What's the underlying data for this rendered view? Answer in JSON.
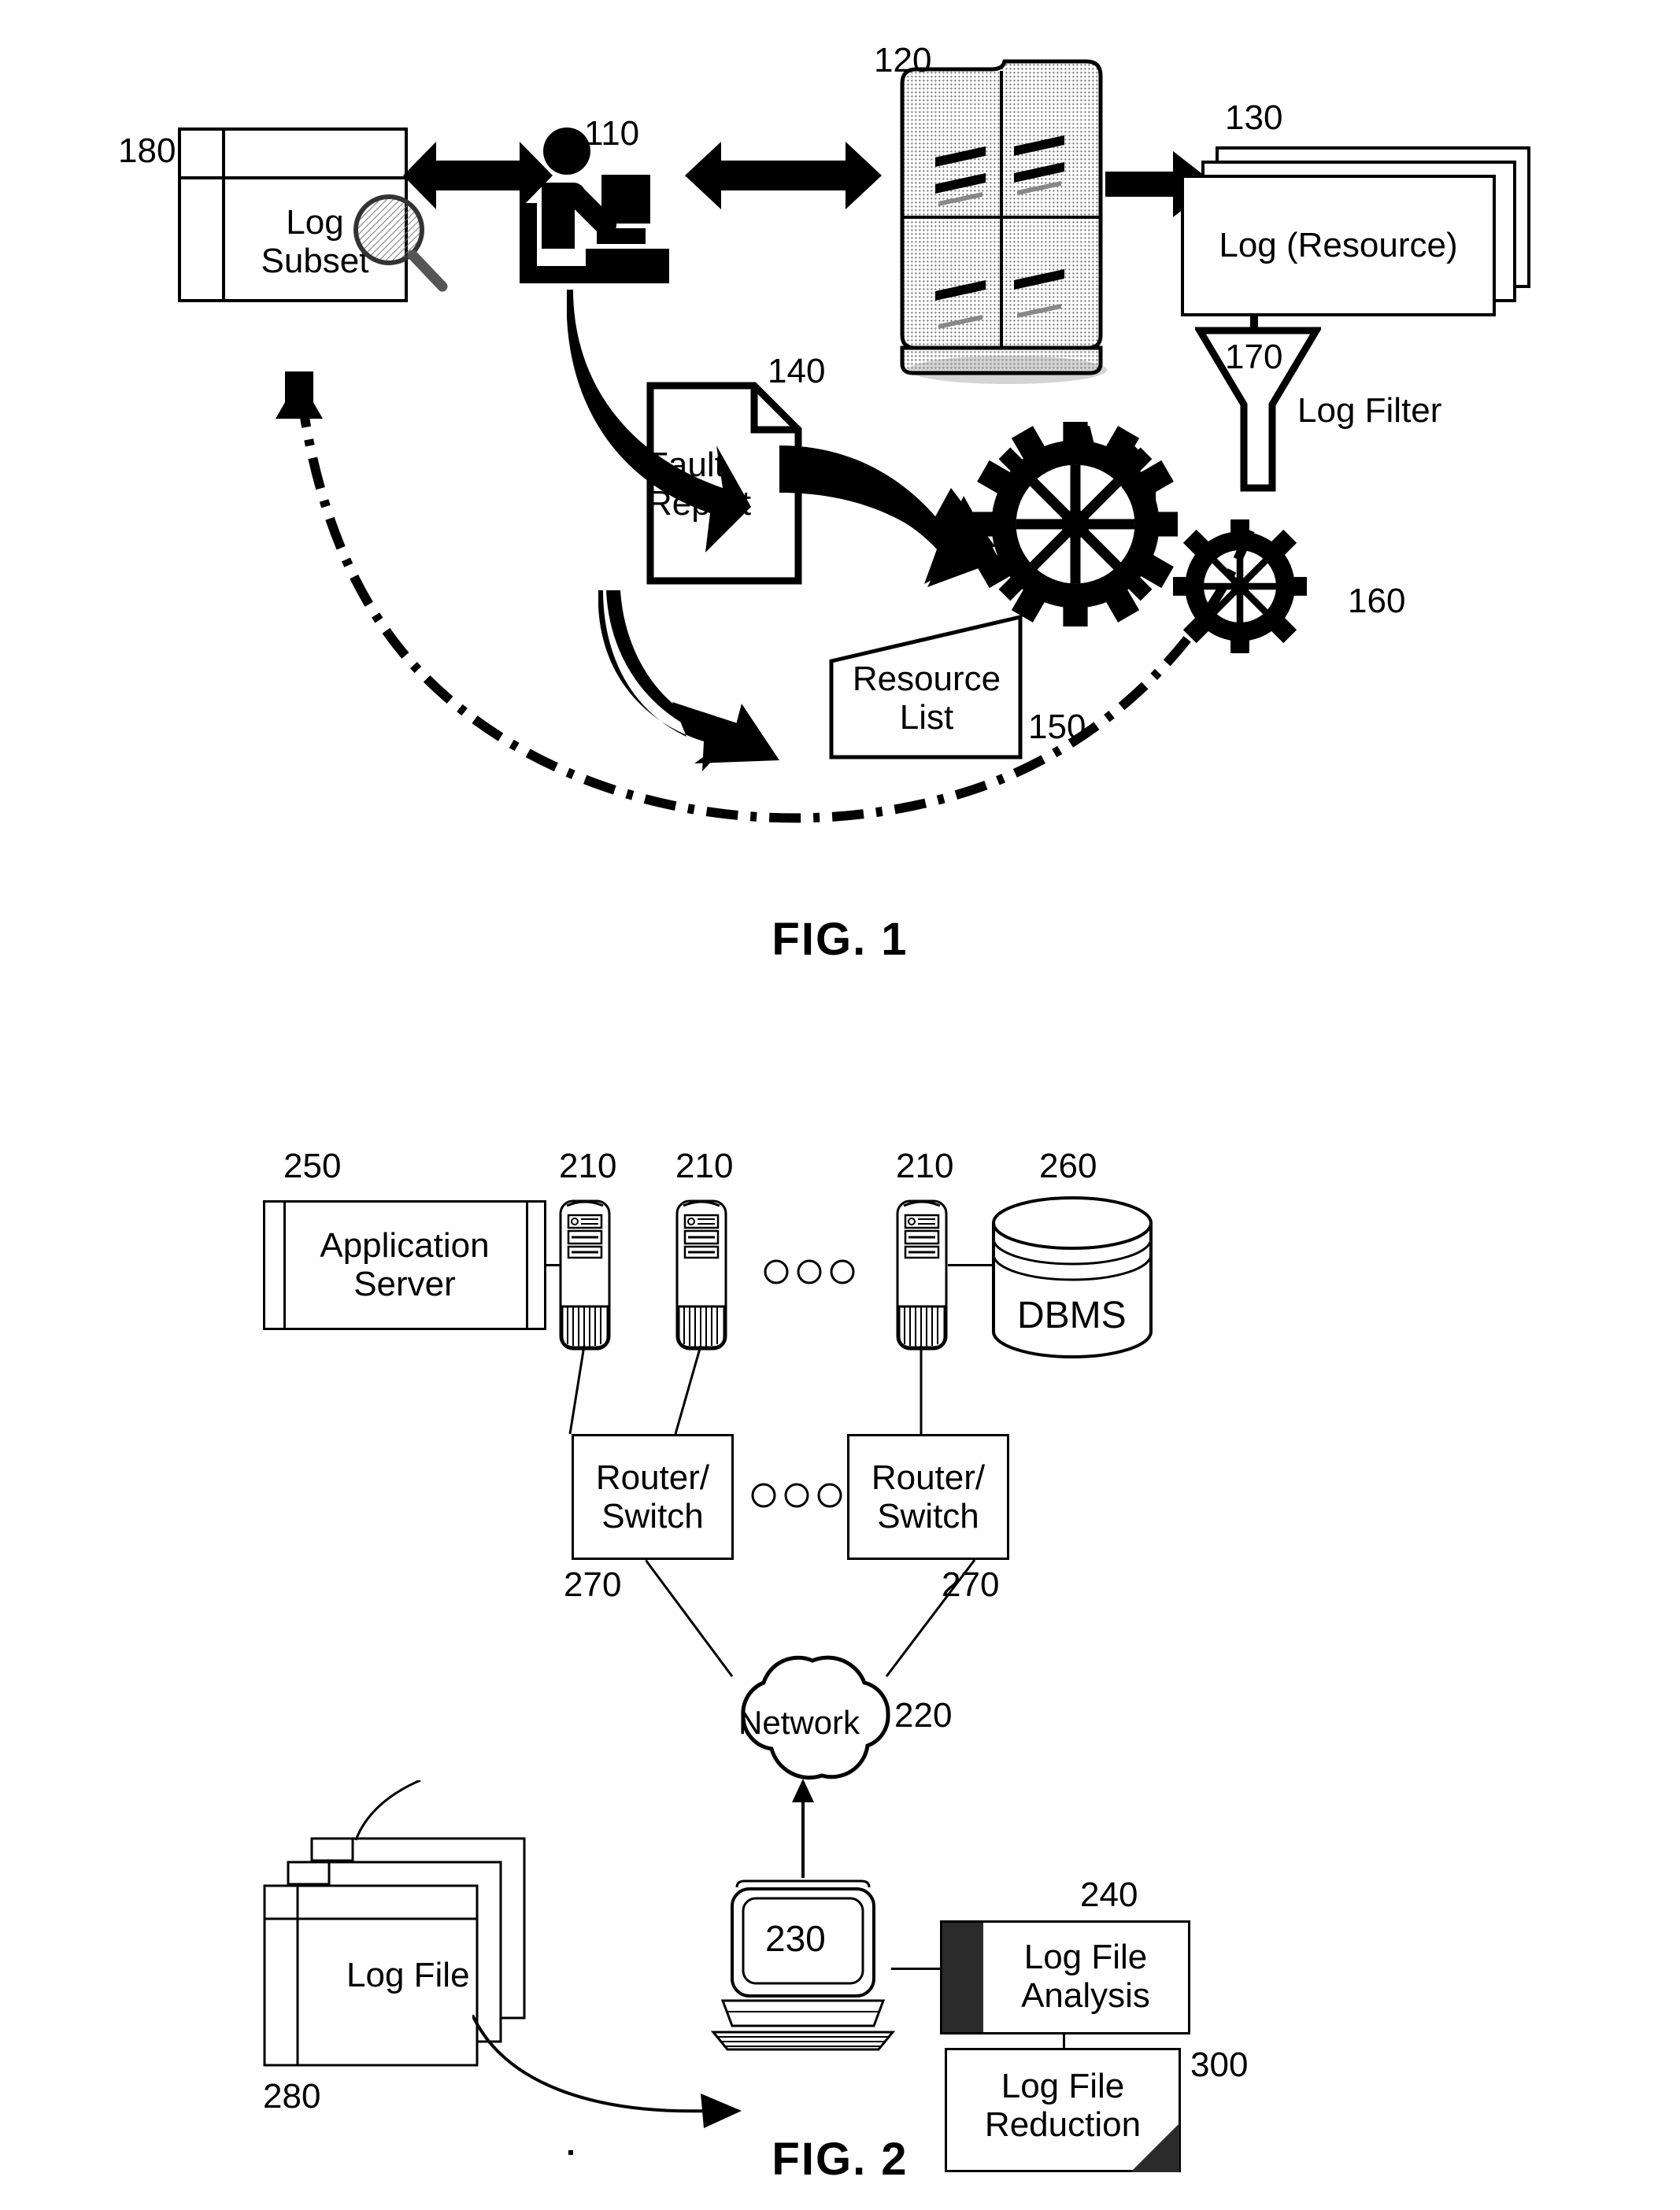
{
  "figures": [
    {
      "id": "fig1",
      "caption": "FIG. 1",
      "nodes": {
        "log_subset": {
          "label_line1": "Log",
          "label_line2": "Subset",
          "ref": "180"
        },
        "user": {
          "ref": "110"
        },
        "server": {
          "ref": "120"
        },
        "log_resource": {
          "label": "Log (Resource)",
          "ref": "130"
        },
        "log_filter": {
          "ref": "170",
          "label": "Log Filter"
        },
        "fault_report": {
          "label_line1": "Fault",
          "label_line2": "Report",
          "ref": "140"
        },
        "resource_list": {
          "label_line1": "Resource",
          "label_line2": "List",
          "ref": "150"
        },
        "gears": {
          "ref": "160"
        }
      }
    },
    {
      "id": "fig2",
      "caption": "FIG. 2",
      "nodes": {
        "application_server": {
          "label_line1": "Application",
          "label_line2": "Server",
          "ref": "250"
        },
        "server_a": {
          "ref": "210"
        },
        "server_b": {
          "ref": "210"
        },
        "server_c": {
          "ref": "210"
        },
        "dbms": {
          "label": "DBMS",
          "ref": "260"
        },
        "router_switch_left": {
          "label_line1": "Router/",
          "label_line2": "Switch",
          "ref": "270"
        },
        "router_switch_right": {
          "label_line1": "Router/",
          "label_line2": "Switch",
          "ref": "270"
        },
        "network": {
          "label": "Network",
          "ref": "220"
        },
        "log_file": {
          "label": "Log File",
          "ref": "280"
        },
        "workstation": {
          "ref": "230"
        },
        "log_file_analysis": {
          "label_line1": "Log File",
          "label_line2": "Analysis",
          "ref": "240"
        },
        "log_file_reduction": {
          "label_line1": "Log File",
          "label_line2": "Reduction",
          "ref": "300"
        }
      }
    }
  ]
}
